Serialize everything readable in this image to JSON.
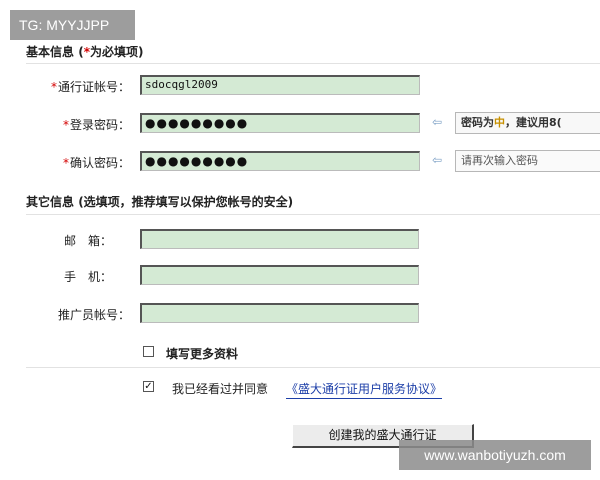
{
  "watermarks": {
    "top": "TG: MYYJJPP",
    "bottom": "www.wanbotiyuzh.com"
  },
  "basic_section": {
    "title": "基本信息",
    "note_open": " (",
    "note_star": "*",
    "note_text": "为必填项)"
  },
  "fields": {
    "account": {
      "star": "*",
      "label": "通行证帐号：",
      "value": "sdocqgl2009"
    },
    "password": {
      "star": "*",
      "label": "登录密码：",
      "value": "●●●●●●●●●"
    },
    "confirm": {
      "star": "*",
      "label": "确认密码：",
      "value": "●●●●●●●●●"
    }
  },
  "hints": {
    "arrow": "⇦",
    "password_strength_prefix": "密码为",
    "password_strength_level": "中",
    "password_strength_suffix": "，建议用8(",
    "confirm_hint": "请再次输入密码"
  },
  "other_section": {
    "title": "其它信息",
    "note": " (选填项，推荐填写以保护您帐号的安全)"
  },
  "optional_fields": {
    "email": {
      "label": "邮　箱：",
      "value": ""
    },
    "phone": {
      "label": "手　机：",
      "value": ""
    },
    "referrer": {
      "label": "推广员帐号：",
      "value": ""
    }
  },
  "more_info": {
    "checked": false,
    "label": "填写更多资料"
  },
  "agreement": {
    "checked": true,
    "check_mark": "✓",
    "label": "我已经看过并同意",
    "link": "《盛大通行证用户服务协议》"
  },
  "submit_label": "创建我的盛大通行证"
}
